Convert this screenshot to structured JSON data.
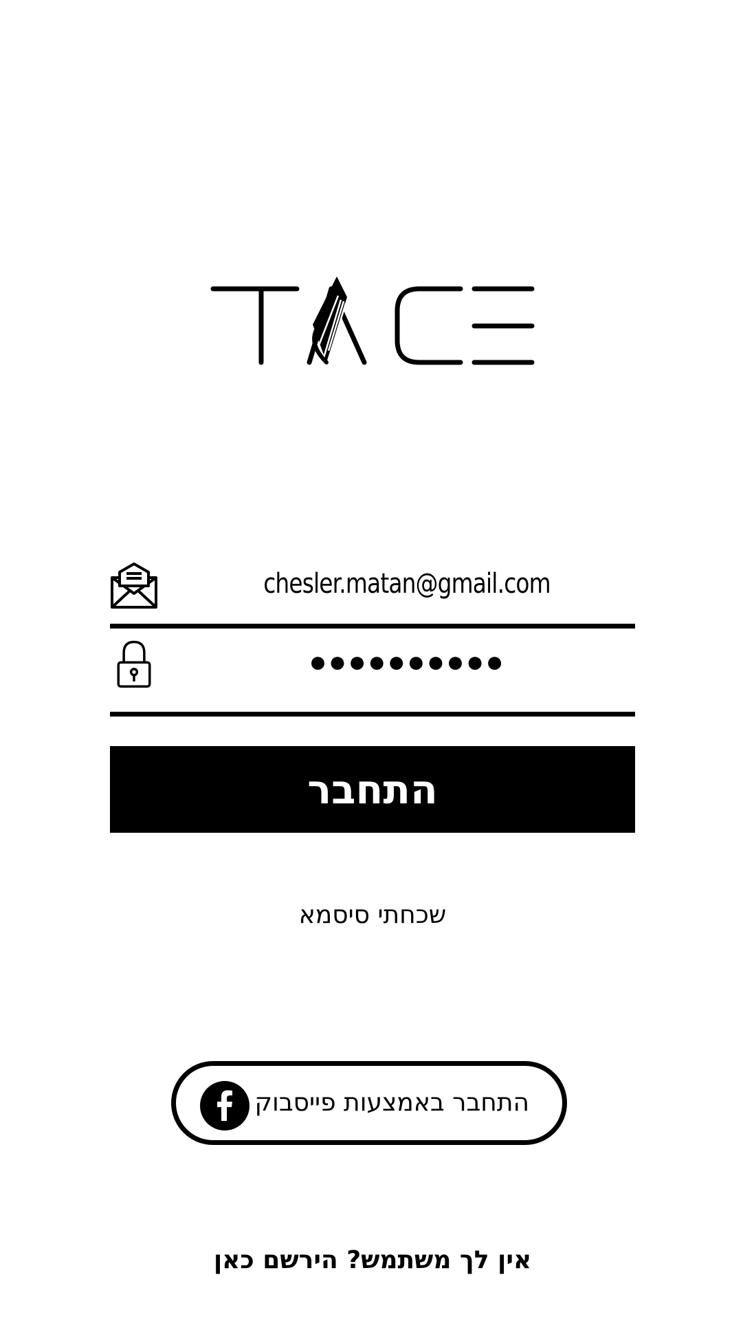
{
  "logo": {
    "text": "TRACE"
  },
  "login_form": {
    "email": {
      "icon": "envelope-icon",
      "value": "chesler.matan@gmail.com"
    },
    "password": {
      "icon": "lock-icon",
      "value": "●●●●●●●●●●"
    },
    "login_label": "התחבר",
    "forgot_password_label": "שכחתי סיסמא"
  },
  "facebook": {
    "icon": "facebook-icon",
    "label": "התחבר באמצעות פייסבוק"
  },
  "register": {
    "label": "אין לך משתמש? הירשם כאן"
  },
  "colors": {
    "background": "#ffffff",
    "foreground": "#000000",
    "button_text": "#ffffff"
  }
}
